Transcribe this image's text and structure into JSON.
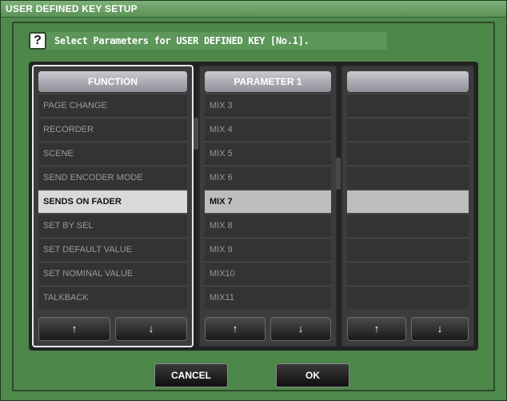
{
  "window": {
    "title": "USER DEFINED KEY SETUP"
  },
  "prompt": {
    "icon": "?",
    "text": "Select Parameters for USER DEFINED KEY [No.1]."
  },
  "columns": [
    {
      "header": "FUNCTION",
      "items": [
        "PAGE CHANGE",
        "RECORDER",
        "SCENE",
        "SEND ENCODER MODE",
        "SENDS ON FADER",
        "SET BY SEL",
        "SET DEFAULT VALUE",
        "SET NOMINAL VALUE",
        "TALKBACK"
      ],
      "selected_index": 4,
      "focused": true
    },
    {
      "header": "PARAMETER 1",
      "items": [
        "MIX 3",
        "MIX 4",
        "MIX 5",
        "MIX 6",
        "MIX 7",
        "MIX 8",
        "MIX 9",
        "MIX10",
        "MIX11"
      ],
      "selected_index": 4,
      "focused": false
    },
    {
      "header": "",
      "items": [
        "",
        "",
        "",
        "",
        "",
        "",
        "",
        "",
        ""
      ],
      "selected_index": 4,
      "focused": false
    }
  ],
  "arrows": {
    "up": "↑",
    "down": "↓"
  },
  "buttons": {
    "cancel": "CANCEL",
    "ok": "OK"
  },
  "colors": {
    "background": "#4f8a4c",
    "selected_row": "#d9d9d9"
  }
}
